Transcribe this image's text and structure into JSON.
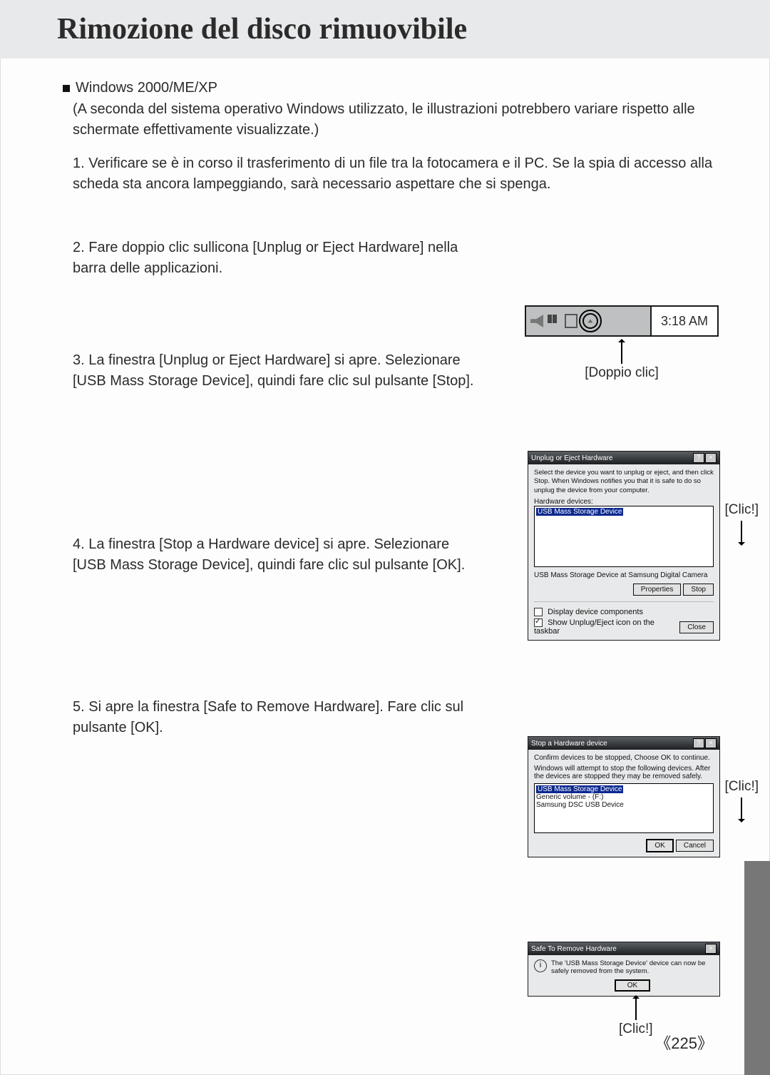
{
  "header": {
    "title": "Rimozione del disco rimuovibile"
  },
  "osLine": "Windows 2000/ME/XP",
  "note": "(A seconda del sistema operativo Windows utilizzato, le illustrazioni potrebbero variare rispetto alle schermate effettivamente visualizzate.)",
  "steps": {
    "s1": "1. Verificare se è in corso il trasferimento di un file tra la fotocamera e il PC. Se la spia di accesso alla scheda sta ancora lampeggiando, sarà necessario aspettare che si spenga.",
    "s2": "2. Fare doppio clic sullicona [Unplug or Eject Hardware] nella barra delle applicazioni.",
    "s3": "3. La finestra [Unplug or Eject Hardware] si apre. Selezionare [USB Mass Storage Device], quindi fare clic sul pulsante [Stop].",
    "s4": "4. La finestra [Stop a Hardware device] si apre. Selezionare [USB Mass Storage Device], quindi fare clic sul pulsante [OK].",
    "s5": "5. Si apre la finestra [Safe to Remove Hardware]. Fare clic sul pulsante [OK]."
  },
  "tray": {
    "time": "3:18 AM",
    "hint": "[Doppio clic]"
  },
  "dlg1": {
    "title": "Unplug or Eject Hardware",
    "desc": "Select the device you want to unplug or eject, and then click Stop. When Windows notifies you that it is safe to do so unplug the device from your computer.",
    "listLabel": "Hardware devices:",
    "item": "USB Mass Storage Device",
    "status": "USB Mass Storage Device at Samsung Digital Camera",
    "btnProps": "Properties",
    "btnStop": "Stop",
    "chk1": "Display device components",
    "chk2": "Show Unplug/Eject icon on the taskbar",
    "btnClose": "Close",
    "annot": "[Clic!]"
  },
  "dlg2": {
    "title": "Stop a Hardware device",
    "line1": "Confirm devices to be stopped, Choose OK to continue.",
    "line2": "Windows will attempt to stop the following devices. After the devices are stopped they may be removed safely.",
    "i1": "USB Mass Storage Device",
    "i2": "Generic volume - (F:)",
    "i3": "Samsung DSC USB Device",
    "btnOK": "OK",
    "btnCancel": "Cancel",
    "annot": "[Clic!]"
  },
  "dlg3": {
    "title": "Safe To Remove Hardware",
    "msg": "The 'USB Mass Storage Device' device can now be safely removed from the system.",
    "btnOK": "OK",
    "annot": "[Clic!]"
  },
  "pageNumber": "《225》"
}
